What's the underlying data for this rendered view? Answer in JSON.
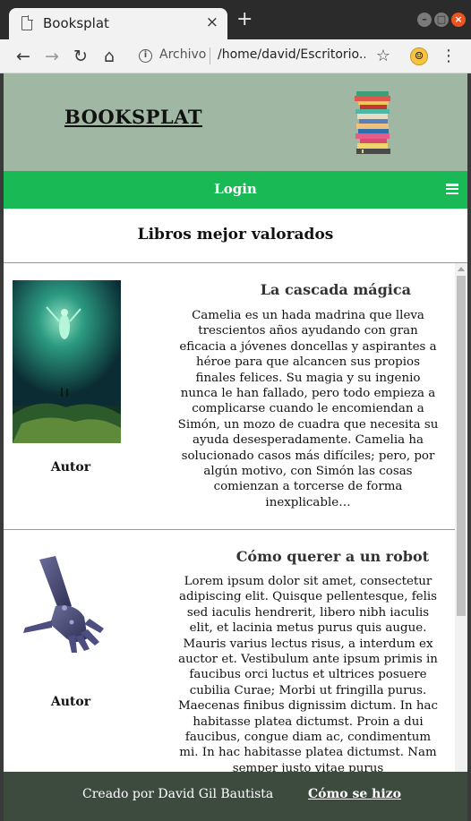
{
  "browser": {
    "tab_title": "Booksplat",
    "tab_close": "×",
    "new_tab": "+",
    "address_label": "Archivo",
    "address_url": "/home/david/Escritorio...",
    "icons": [
      "page-icon",
      "back-icon",
      "forward-icon",
      "reload-icon",
      "home-icon",
      "info-icon",
      "star-icon",
      "extension-icon",
      "menu-icon"
    ]
  },
  "header": {
    "brand": "BOOKSPLAT",
    "logo_icon": "book-stack-icon",
    "background": "#a0b8a3"
  },
  "nav": {
    "login": "Login",
    "menu_icon": "hamburger-icon",
    "background": "#19b955"
  },
  "section": {
    "title": "Libros mejor valorados"
  },
  "books": [
    {
      "title": "La cascada mágica",
      "author": "Autor",
      "cover_icon": "fantasy-cover-image",
      "description": "Camelia es un hada madrina que lleva trescientos años ayudando con gran eficacia a jóvenes doncellas y aspirantes a héroe para que alcancen sus propios finales felices. Su magia y su ingenio nunca le han fallado, pero todo empieza a complicarse cuando le encomiendan a Simón, un mozo de cuadra que necesita su ayuda desesperadamente. Camelia ha solucionado casos más difíciles; pero, por algún motivo, con Simón las cosas comienzan a torcerse de forma inexplicable…"
    },
    {
      "title": "Cómo querer a un robot",
      "author": "Autor",
      "cover_icon": "robot-hand-image",
      "description": "Lorem ipsum dolor sit amet, consectetur adipiscing elit. Quisque pellentesque, felis sed iaculis hendrerit, libero nibh iaculis elit, et lacinia metus purus quis augue. Mauris varius lectus risus, a interdum ex auctor et. Vestibulum ante ipsum primis in faucibus orci luctus et ultrices posuere cubilia Curae; Morbi ut fringilla purus. Maecenas finibus dignissim dictum. In hac habitasse platea dictumst. Proin a dui faucibus, congue diam ac, condimentum mi. In hac habitasse platea dictumst. Nam semper justo vitae purus"
    }
  ],
  "footer": {
    "credit": "Creado por David Gil Bautista",
    "how_link": "Cómo se hizo",
    "background": "#3d4b3f"
  }
}
